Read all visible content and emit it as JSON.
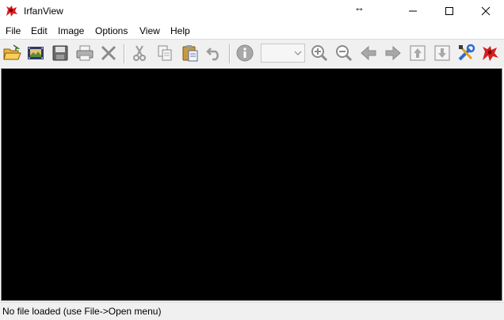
{
  "window": {
    "title": "IrfanView",
    "app_icon": "irfanview-red-cat-icon",
    "controls": [
      "minimize-icon",
      "maximize-icon",
      "close-icon"
    ]
  },
  "menu": [
    {
      "label": "File"
    },
    {
      "label": "Edit"
    },
    {
      "label": "Image"
    },
    {
      "label": "Options"
    },
    {
      "label": "View"
    },
    {
      "label": "Help"
    }
  ],
  "toolbar": {
    "buttons": [
      "open-folder-icon",
      "slideshow-film-icon",
      "save-disk-icon",
      "print-icon",
      "delete-x-icon",
      "cut-scissors-icon",
      "copy-icon",
      "paste-icon",
      "undo-icon",
      "info-icon",
      "zoom-in-icon",
      "zoom-out-icon",
      "previous-arrow-icon",
      "next-arrow-icon",
      "first-file-icon",
      "last-file-icon",
      "properties-tools-icon",
      "irfanview-logo-icon"
    ],
    "zoom_value": ""
  },
  "canvas": {
    "background": "#000000"
  },
  "status": {
    "text": "No file loaded (use File->Open menu)"
  },
  "colors": {
    "accent_red": "#d42020",
    "toolbar_bg": "#f0f0f0"
  }
}
